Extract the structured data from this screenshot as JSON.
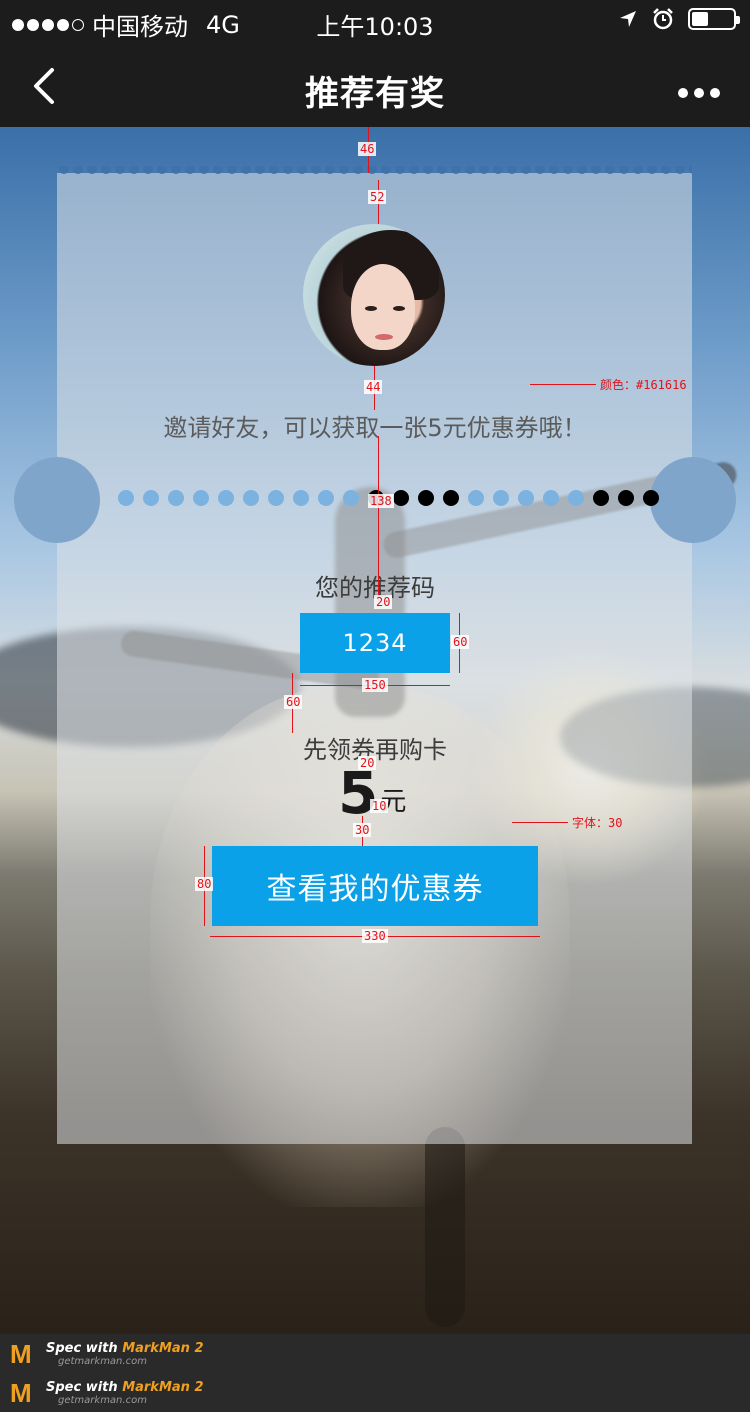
{
  "status_bar": {
    "carrier": "中国移动",
    "network": "4G",
    "time": "上午10:03"
  },
  "nav": {
    "title": "推荐有奖"
  },
  "card": {
    "invite_text": "邀请好友，可以获取一张5元优惠券哦！",
    "code_label": "您的推荐码",
    "code": "1234",
    "first_label": "先领券再购卡",
    "amount": "5",
    "amount_unit": "元",
    "cta_label": "查看我的优惠券"
  },
  "annotations": {
    "top_gap": "46",
    "avatar_gap": "52",
    "text_gap": "44",
    "color_note": "颜色：#161616",
    "divider_gap": "138",
    "code_label_gap": "20",
    "code_height": "60",
    "code_width": "150",
    "section_gap": "60",
    "amount_gap": "20",
    "unit_gap": "10",
    "cta_gap": "30",
    "font_note": "字体：30",
    "cta_height": "80",
    "cta_width": "330"
  },
  "footer": {
    "lines": [
      {
        "title": "Spec with",
        "brand": "MarkMan 2",
        "url": "getmarkman.com"
      },
      {
        "title": "Spec with",
        "brand": "MarkMan 2",
        "url": "getmarkman.com"
      }
    ]
  },
  "colors": {
    "accent": "#0aa1e8",
    "annotation": "#e0131b",
    "text_dark": "#161616"
  }
}
